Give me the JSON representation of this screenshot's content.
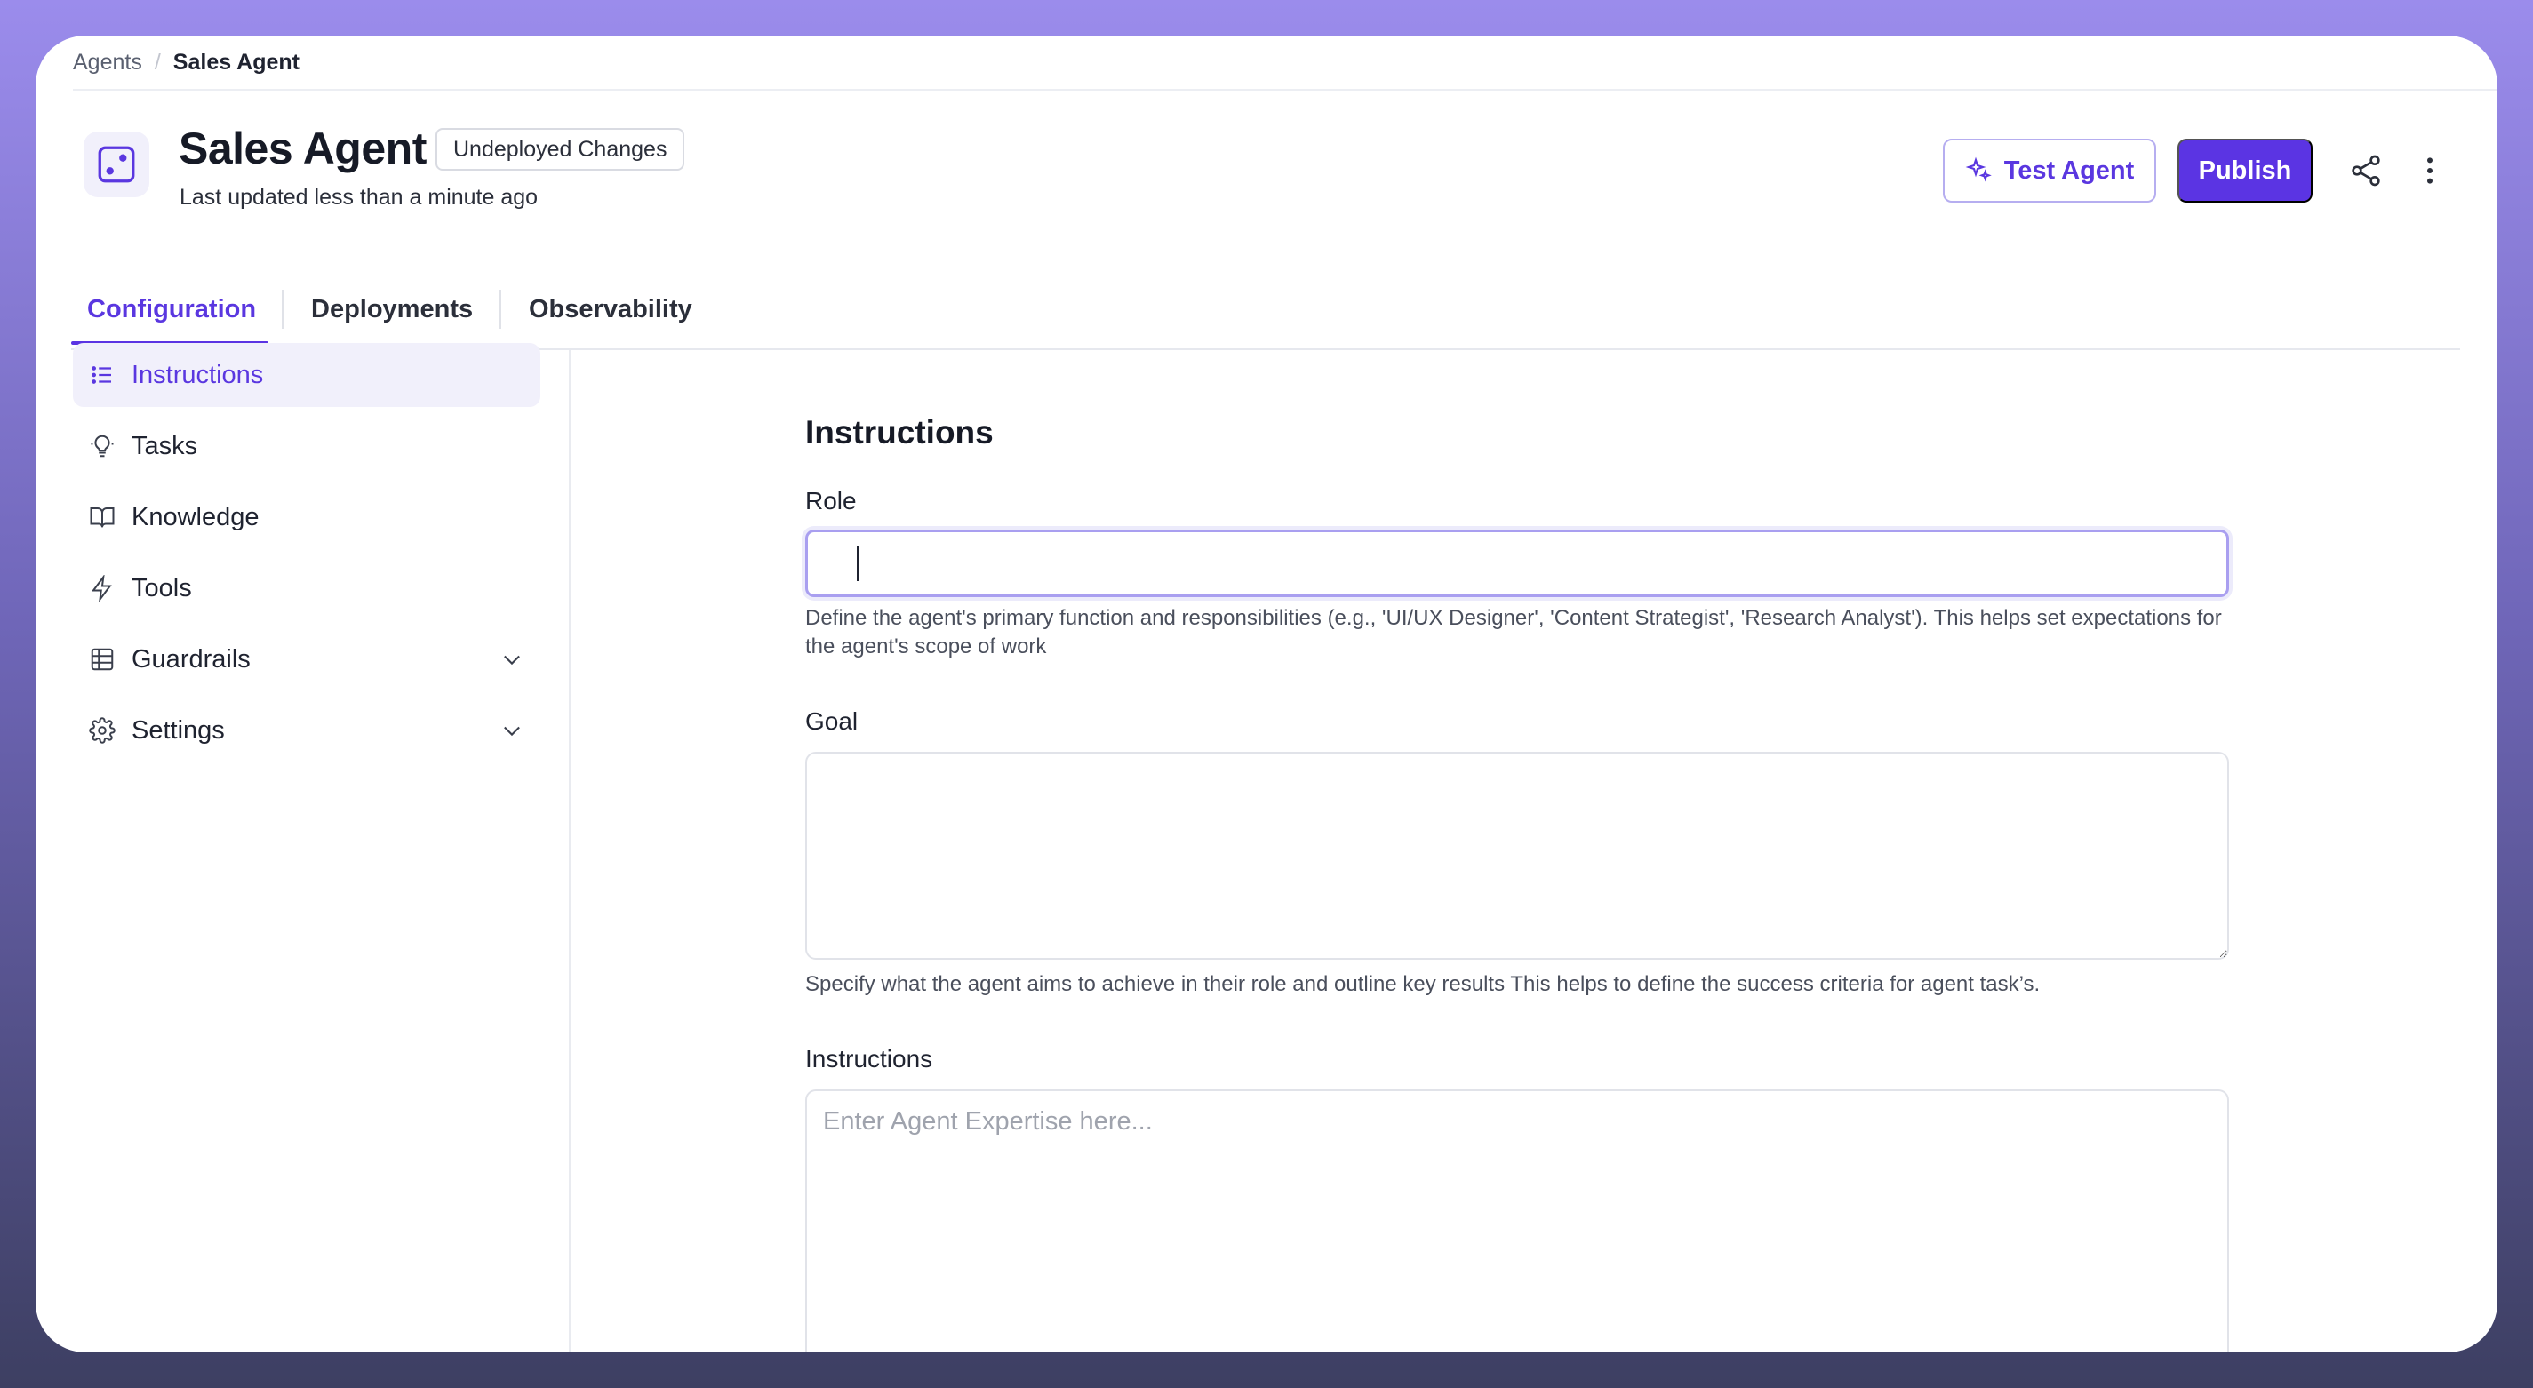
{
  "breadcrumb": {
    "parent": "Agents",
    "separator": "/",
    "current": "Sales Agent"
  },
  "header": {
    "title": "Sales Agent",
    "badge": "Undeployed Changes",
    "updated": "Last updated less than a minute ago",
    "test_label": "Test Agent",
    "publish_label": "Publish"
  },
  "tabs": [
    {
      "label": "Configuration",
      "active": true
    },
    {
      "label": "Deployments",
      "active": false
    },
    {
      "label": "Observability",
      "active": false
    }
  ],
  "sidebar": {
    "items": [
      {
        "label": "Instructions",
        "icon": "list-icon",
        "active": true
      },
      {
        "label": "Tasks",
        "icon": "lightbulb-icon"
      },
      {
        "label": "Knowledge",
        "icon": "book-icon"
      },
      {
        "label": "Tools",
        "icon": "lightning-icon"
      },
      {
        "label": "Guardrails",
        "icon": "table-icon",
        "expandable": true
      },
      {
        "label": "Settings",
        "icon": "gear-icon",
        "expandable": true
      }
    ]
  },
  "main": {
    "title": "Instructions",
    "role": {
      "label": "Role",
      "value": "",
      "hint": "Define the agent's primary function and responsibilities (e.g., 'UI/UX Designer', 'Content Strategist', 'Research Analyst'). This helps set expectations for the agent's scope of work"
    },
    "goal": {
      "label": "Goal",
      "value": "",
      "hint": "Specify what the agent aims to achieve in their role and outline key results This helps to define the success criteria for agent task’s."
    },
    "instructions": {
      "label": "Instructions",
      "placeholder": "Enter Agent Expertise here..."
    }
  },
  "colors": {
    "accent": "#5b34e3",
    "accent_light": "#f1f0fb"
  }
}
